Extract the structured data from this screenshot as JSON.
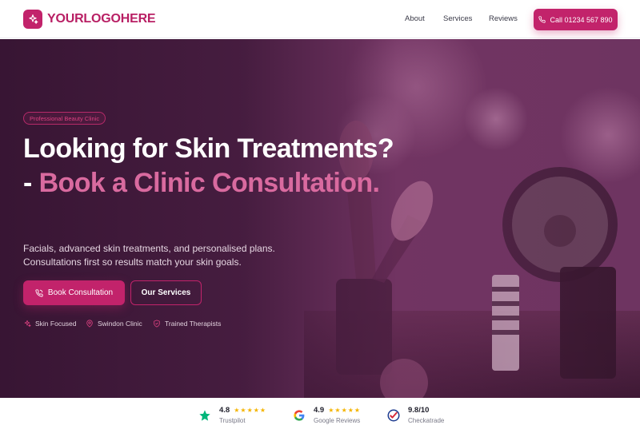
{
  "nav": {
    "logo_text": "YOURLOGOHERE",
    "links": [
      {
        "label": "About"
      },
      {
        "label": "Services"
      },
      {
        "label": "Reviews"
      }
    ],
    "call_label": "Call 01234 567 890",
    "icons": {
      "logo": "sparkle-icon",
      "call": "phone-icon"
    }
  },
  "hero": {
    "badge": "Professional Beauty Clinic",
    "headline_white": "Looking for Skin Treatments? - ",
    "headline_accent": "Book a Clinic Consultation.",
    "subtitle": "Facials, advanced skin treatments, and personalised plans. Consultations first so results match your skin goals.",
    "primary_button": "Book Consultation",
    "secondary_button": "Our Services",
    "features": [
      {
        "label": "Skin Focused",
        "icon": "sparkle-icon"
      },
      {
        "label": "Swindon Clinic",
        "icon": "map-pin-icon"
      },
      {
        "label": "Trained Therapists",
        "icon": "shield-check-icon"
      }
    ]
  },
  "reviews": [
    {
      "score": "4.8",
      "stars": "★★★★★",
      "source": "Trustpilot",
      "icon": "trustpilot-star-icon"
    },
    {
      "score": "4.9",
      "stars": "★★★★★",
      "source": "Google Reviews",
      "icon": "google-g-icon"
    },
    {
      "score": "9.8/10",
      "stars": "",
      "source": "Checkatrade",
      "icon": "checkatrade-icon"
    }
  ],
  "colors": {
    "brand": "#c2236b",
    "accent_text": "#d96a9f",
    "hero_bg": "#3a1d35",
    "star": "#f4b400"
  }
}
